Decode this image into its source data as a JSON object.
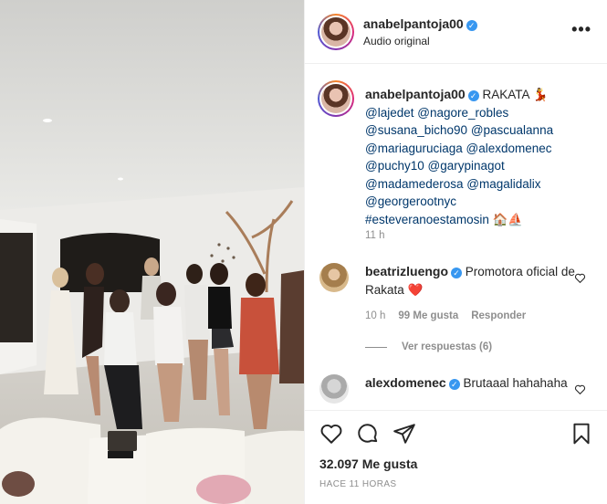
{
  "post": {
    "username": "anabelpantoja00",
    "subtitle": "Audio original",
    "more_label": "•••",
    "caption": {
      "username": "anabelpantoja00",
      "text_start": "RAKATA",
      "mentions": [
        "@lajedet",
        "@nagore_robles",
        "@susana_bicho90",
        "@pascualanna",
        "@mariaguruciaga",
        "@alexdomenec",
        "@puchy10",
        "@garypinagot",
        "@madamederosa",
        "@magalidalix",
        "@georgerootnyc"
      ],
      "hashtag": "#esteveranoestamosin",
      "emoji_end": "🏠⛵",
      "emoji_after_title": "💃",
      "time": "11 h"
    },
    "comments": [
      {
        "username": "beatrizluengo",
        "text": "Promotora oficial de Rakata",
        "emoji": "❤️",
        "time": "10 h",
        "likes": "99 Me gusta",
        "reply_label": "Responder",
        "view_replies": "Ver respuestas (6)"
      },
      {
        "username": "alexdomenec",
        "text": "Brutaaal hahahaha"
      }
    ],
    "like_count": "32.097 Me gusta",
    "timestamp": "HACE 11 HORAS"
  },
  "icons": {
    "verified": "verified-badge-icon",
    "heart": "heart-icon",
    "comment": "comment-icon",
    "share": "share-icon",
    "save": "bookmark-icon",
    "more": "more-options-icon"
  },
  "colors": {
    "verified_blue": "#3897f0",
    "mention": "#00376b",
    "muted": "#8e8e8e",
    "heart_red": "#ed4956"
  }
}
